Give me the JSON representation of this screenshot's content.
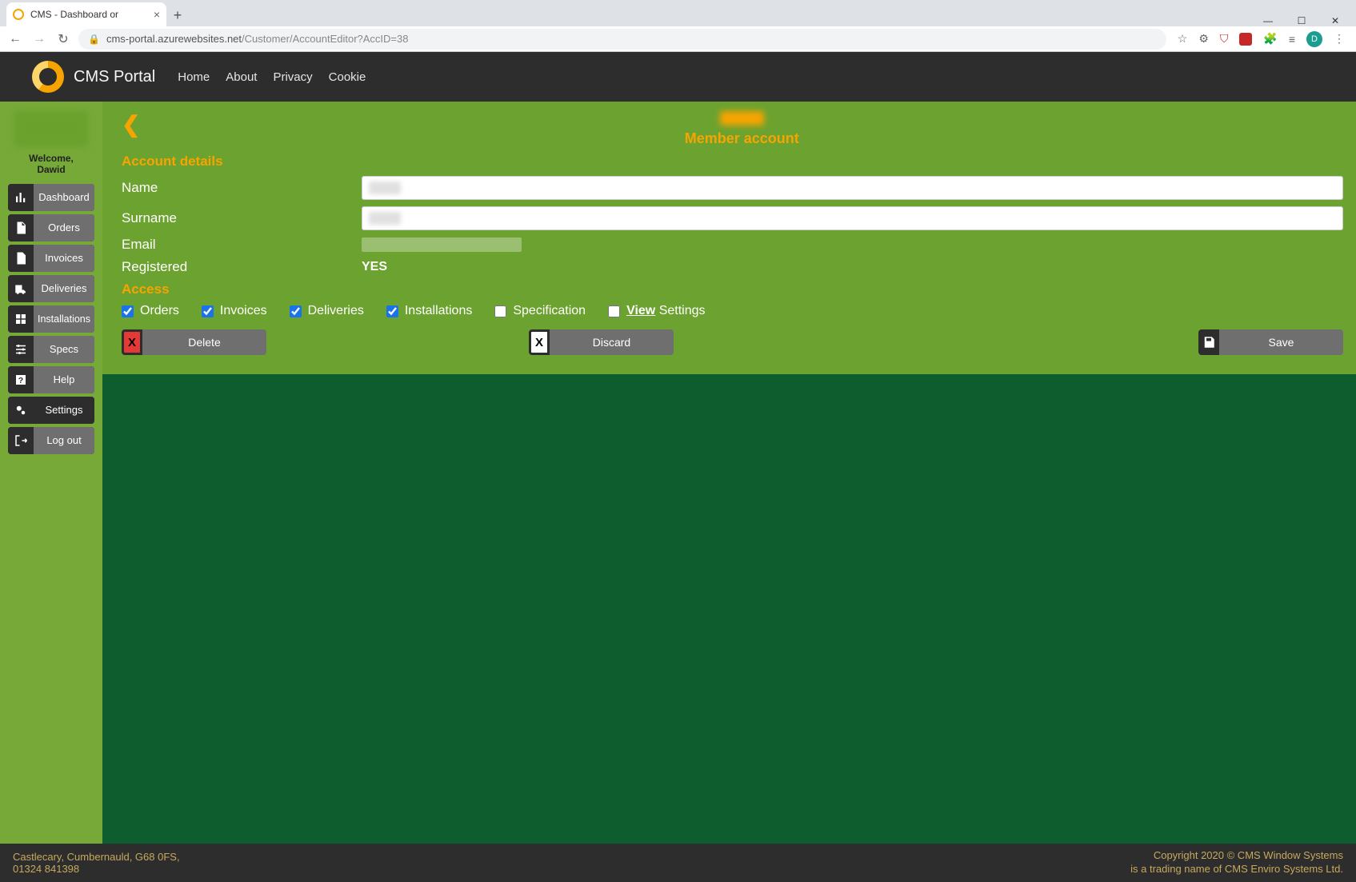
{
  "browser": {
    "tab_title": "CMS - Dashboard   or",
    "new_tab": "+",
    "url_host": "cms-portal.azurewebsites.net",
    "url_path": "/Customer/AccountEditor?AccID=38",
    "avatar_initial": "D",
    "win_min": "—",
    "win_max": "☐",
    "win_close": "✕",
    "back": "←",
    "fwd": "→",
    "reload": "↻",
    "star": "☆",
    "puzzle": "🧩",
    "list": "≡",
    "more": "⋮"
  },
  "header": {
    "brand": "CMS Portal",
    "nav": {
      "home": "Home",
      "about": "About",
      "privacy": "Privacy",
      "cookie": "Cookie"
    }
  },
  "sidebar": {
    "welcome_line1": "Welcome,",
    "welcome_line2": "Dawid",
    "items": [
      {
        "label": "Dashboard"
      },
      {
        "label": "Orders"
      },
      {
        "label": "Invoices"
      },
      {
        "label": "Deliveries"
      },
      {
        "label": "Installations"
      },
      {
        "label": "Specs"
      },
      {
        "label": "Help"
      },
      {
        "label": "Settings"
      },
      {
        "label": "Log out"
      }
    ]
  },
  "panel": {
    "back_chevron": "❮",
    "title": "Member account",
    "account_details": "Account details",
    "labels": {
      "name": "Name",
      "surname": "Surname",
      "email": "Email",
      "registered": "Registered"
    },
    "values": {
      "registered": "YES"
    },
    "access_title": "Access",
    "access": {
      "orders": {
        "label": "Orders",
        "checked": true
      },
      "invoices": {
        "label": "Invoices",
        "checked": true
      },
      "deliveries": {
        "label": "Deliveries",
        "checked": true
      },
      "installations": {
        "label": "Installations",
        "checked": true
      },
      "specification": {
        "label": "Specification",
        "checked": false
      },
      "view_settings": {
        "label_strong": "View",
        "label_rest": " Settings",
        "checked": false
      }
    },
    "buttons": {
      "delete": "Delete",
      "discard": "Discard",
      "save": "Save"
    }
  },
  "footer": {
    "address_line1": "Castlecary, Cumbernauld, G68 0FS,",
    "address_line2": "01324 841398",
    "copyright_line1": "Copyright 2020 © CMS Window Systems",
    "copyright_line2": "is a trading name of CMS Enviro Systems Ltd."
  }
}
